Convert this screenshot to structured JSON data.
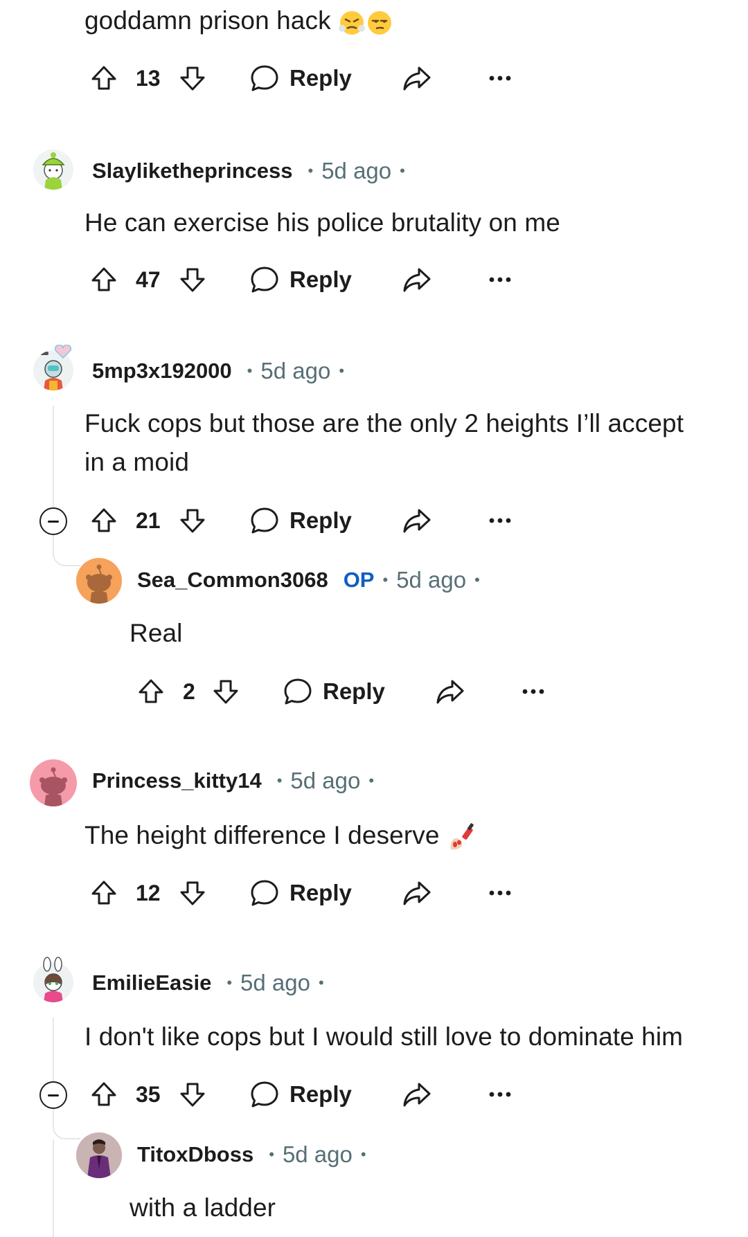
{
  "comments": [
    {
      "body": "goddamn prison hack",
      "emoji": [
        "face-with-steam-from-nose-icon",
        "unamused-face-icon"
      ],
      "votes": "13",
      "reply_label": "Reply"
    },
    {
      "author": "Slayliketheprincess",
      "time": "5d ago",
      "body": "He can exercise his police brutality on me",
      "votes": "47",
      "reply_label": "Reply"
    },
    {
      "author": "5mp3x192000",
      "time": "5d ago",
      "body_line1": "Fuck cops but those are the only 2 heights I’ll accept",
      "body_line2": "in a moid",
      "votes": "21",
      "reply_label": "Reply"
    },
    {
      "author": "Sea_Common3068",
      "op_label": "OP",
      "time": "5d ago",
      "body": "Real",
      "votes": "2",
      "reply_label": "Reply"
    },
    {
      "author": "Princess_kitty14",
      "time": "5d ago",
      "body": "The height difference I deserve",
      "emoji": [
        "nail-polish-icon"
      ],
      "votes": "12",
      "reply_label": "Reply"
    },
    {
      "author": "EmilieEasie",
      "time": "5d ago",
      "body": "I don't like cops but I would still love to dominate him",
      "votes": "35",
      "reply_label": "Reply"
    },
    {
      "author": "TitoxDboss",
      "time": "5d ago",
      "body": "with a ladder"
    }
  ],
  "meta_separator": "•",
  "colors": {
    "text": "#1c1c1c",
    "muted": "#576f76",
    "op": "#0f5ec2",
    "thread_line": "#e5e7e9"
  }
}
